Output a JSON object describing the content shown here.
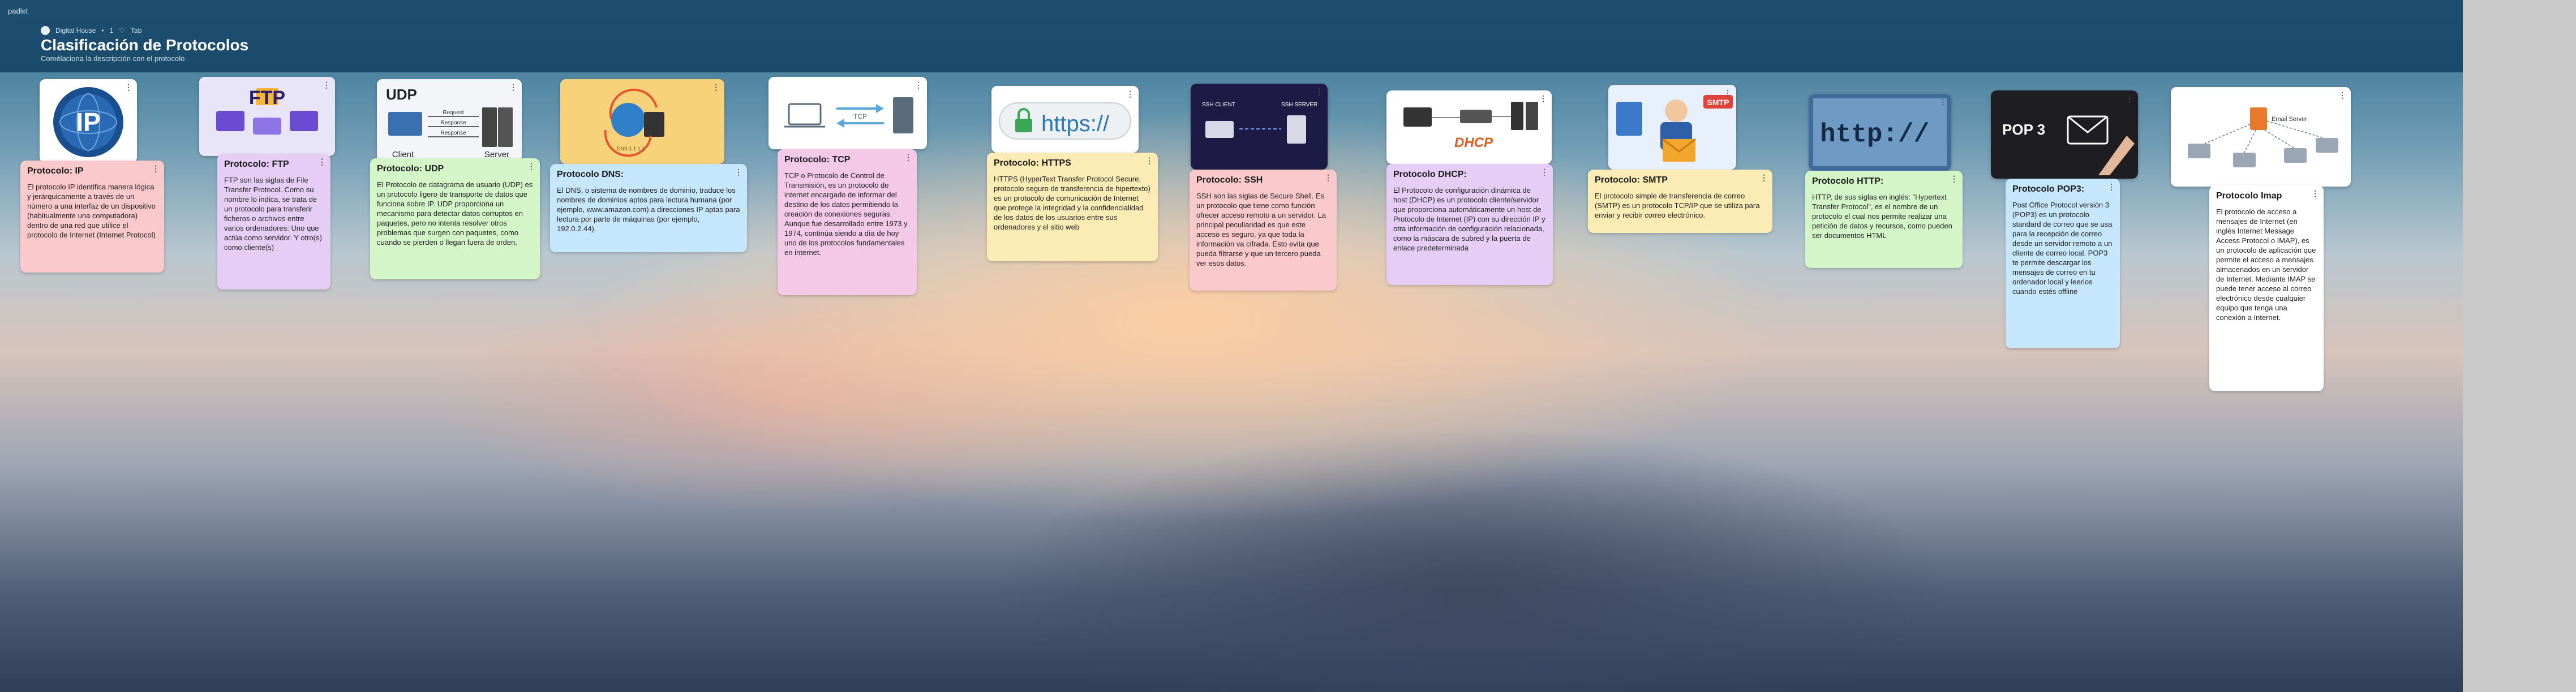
{
  "app": {
    "label": "padlet",
    "breadcrumb": [
      "Digital House",
      "•",
      "1",
      "♡",
      "Tab"
    ],
    "title": "Clasificación de Protocolos",
    "subtitle": "Comélaciona la descripción con el protocolo"
  },
  "images": {
    "ip": "IP",
    "ftp": "FTP",
    "udp_title": "UDP",
    "udp_client": "Client",
    "udp_server": "Server",
    "udp_req": "Request",
    "udp_resp1": "Response",
    "udp_resp2": "Response",
    "dns_text": "DNS 1.1.1.1",
    "tcp": "TCP",
    "https": "https://",
    "ssh1": "SSH CLIENT",
    "ssh2": "SSH SERVER",
    "dhcp": "DHCP",
    "smtp": "SMTP",
    "http": "http://",
    "pop3": "POP 3",
    "imap_server": "Email Server"
  },
  "cards": [
    {
      "title": "Protocolo: IP",
      "text": "El protocolo IP identifica manera lógica y jerárquicamente a través de un número a una interfaz de un dispositivo (habitualmente una computadora) dentro de una red que utilice el protocolo de Internet (Internet Protocol)"
    },
    {
      "title": "Protocolo: FTP",
      "text": "FTP son las siglas de File Transfer Protocol. Como su nombre lo indica, se trata de un protocolo para transferir ficheros o archivos entre varios ordenadores: Uno que actúa como servidor. Y otro(s) como cliente(s)"
    },
    {
      "title": "Protocolo: UDP",
      "text": "El Protocolo de datagrama de usuario (UDP) es un protocolo ligero de transporte de datos que funciona sobre IP. UDP proporciona un mecanismo para detectar datos corruptos en paquetes, pero no intenta resolver otros problemas que surgen con paquetes, como cuando se pierden o llegan fuera de orden."
    },
    {
      "title": "Protocolo DNS:",
      "text": "El DNS, o sistema de nombres de dominio, traduce los nombres de dominios aptos para lectura humana (por ejemplo, www.amazon.com) a direcciones IP aptas para lectura por parte de máquinas (por ejemplo, 192.0.2.44)."
    },
    {
      "title": "Protocolo: TCP",
      "text": "TCP o Protocolo de Control de Transmisión, es un protocolo de internet encargado de informar del destino de los datos permitiendo la creación de conexiones seguras. Aunque fue desarrollado entre 1973 y 1974, continúa siendo a día de hoy uno de los protocolos fundamentales en internet."
    },
    {
      "title": "Protocolo: HTTPS",
      "text": "HTTPS (HyperText Transfer Protocol Secure, protocolo seguro de transferencia de hipertexto) es un protocolo de comunicación de Internet que protege la integridad y la confidencialidad de los datos de los usuarios entre sus ordenadores y el sitio web"
    },
    {
      "title": "Protocolo: SSH",
      "text": "SSH son las siglas de Secure Shell. Es un protocolo que tiene como función ofrecer acceso remoto a un servidor. La principal peculiaridad es que este acceso es seguro, ya que toda la información va cifrada. Esto evita que pueda filtrarse y que un tercero pueda ver esos datos."
    },
    {
      "title": "Protocolo DHCP:",
      "text": "El Protocolo de configuración dinámica de host (DHCP) es un protocolo cliente/servidor que proporciona automáticamente un host de Protocolo de Internet (IP) con su dirección IP y otra información de configuración relacionada, como la máscara de subred y la puerta de enlace predeterminada"
    },
    {
      "title": "Protocolo: SMTP",
      "text": "El protocolo simple de transferencia de correo (SMTP) es un protocolo TCP/IP que se utiliza para enviar y recibir correo electrónico."
    },
    {
      "title": "Protocolo HTTP:",
      "text": "HTTP, de sus siglas en inglés: \"Hypertext Transfer Protocol\", es el nombre de un protocolo el cual nos permite realizar una petición de datos y recursos, como pueden ser documentos HTML"
    },
    {
      "title": "Protocolo POP3:",
      "text": "Post Office Protocol versión 3 (POP3) es un protocolo standard de correo que se usa para la recepción de correo desde un servidor remoto a un cliente de correo local. POP3 te permite descargar los mensajes de correo en tu ordenador local y leerlos cuando estés offline"
    },
    {
      "title": "Protocolo Imap",
      "text": "El protocolo de acceso a mensajes de Internet (en inglés Internet Message Access Protocol o IMAP), es un protocolo de aplicación que permite el acceso a mensajes almacenados en un servidor de Internet. Mediante IMAP se puede tener acceso al correo electrónico desde cualquier equipo que tenga una conexión a Internet."
    }
  ],
  "card_menu": "⋮"
}
